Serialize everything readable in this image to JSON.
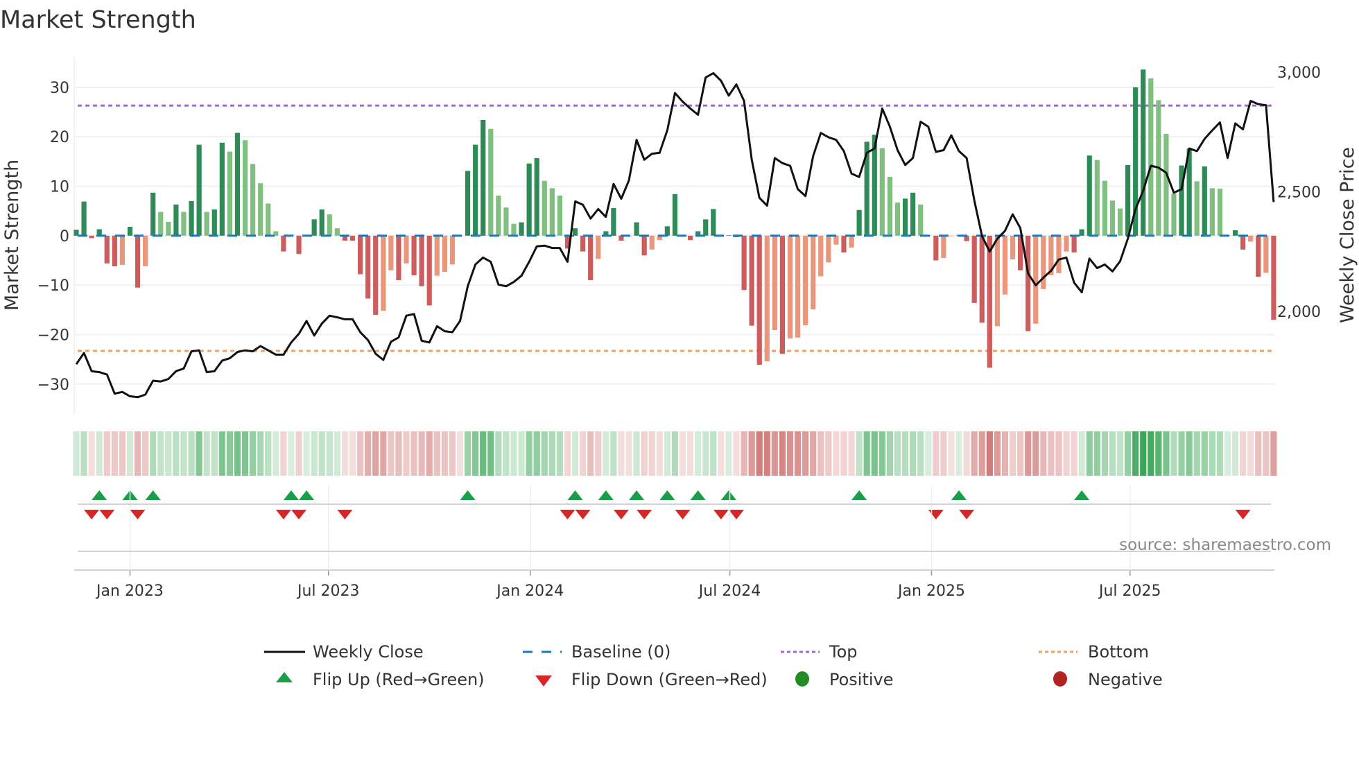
{
  "chart_data": {
    "type": "bar",
    "title": "Market Strength",
    "ylabel": "Market Strength",
    "y2label": "Weekly Close Price",
    "ylim": [
      -36.2,
      36.3
    ],
    "y2lim": [
      1568,
      3067
    ],
    "yticks": [
      30,
      20,
      10,
      0,
      -10,
      -20,
      -30
    ],
    "yticklabels": [
      "30",
      "20",
      "10",
      "0",
      "−10",
      "−20",
      "−30"
    ],
    "y2ticks": [
      3000,
      2500,
      2000
    ],
    "y2ticklabels": [
      "3,000",
      "2,500",
      "2,000"
    ],
    "x": {
      "start": "2022-11-13",
      "freq": "weekly"
    },
    "xticks": [
      {
        "date": "2023-01-01",
        "label": "Jan 2023"
      },
      {
        "date": "2023-07-01",
        "label": "Jul 2023"
      },
      {
        "date": "2024-01-01",
        "label": "Jan 2024"
      },
      {
        "date": "2024-07-01",
        "label": "Jul 2024"
      },
      {
        "date": "2025-01-01",
        "label": "Jan 2025"
      },
      {
        "date": "2025-07-01",
        "label": "Jul 2025"
      }
    ],
    "top_level": 26.3,
    "bottom_level": -23.3,
    "baseline": 0,
    "grid": true,
    "legend_position": "bottom",
    "strength": [
      1.2,
      6.9,
      -0.5,
      1.3,
      -5.6,
      -6.2,
      -5.9,
      1.8,
      -10.5,
      -6.2,
      8.7,
      4.8,
      2.8,
      6.3,
      4.8,
      7.0,
      18.4,
      4.8,
      5.3,
      18.8,
      17.0,
      20.8,
      19.3,
      14.5,
      10.6,
      6.5,
      0.9,
      -3.2,
      0.2,
      -3.7,
      0.2,
      3.3,
      5.3,
      4.3,
      1.5,
      -1.0,
      -1.0,
      -7.8,
      -12.7,
      -16.0,
      -15.2,
      -7.0,
      -9.0,
      -5.6,
      -8.0,
      -10.2,
      -14.1,
      -8.1,
      -7.3,
      -5.8,
      -0.1,
      13.1,
      18.4,
      23.4,
      21.6,
      8.1,
      5.7,
      2.4,
      2.7,
      14.6,
      15.7,
      11.1,
      9.6,
      8.1,
      -2.6,
      1.5,
      -3.2,
      -9.0,
      -4.7,
      0.9,
      5.6,
      -1.0,
      -0.1,
      2.7,
      -4.0,
      -2.8,
      -0.9,
      1.9,
      8.4,
      -0.2,
      -0.9,
      0.9,
      3.3,
      5.4,
      -0.1,
      0.1,
      -0.3,
      -11.0,
      -18.2,
      -26.1,
      -25.4,
      -19.1,
      -23.9,
      -20.8,
      -20.6,
      -18.1,
      -14.9,
      -8.2,
      -5.4,
      -1.8,
      -3.4,
      -2.4,
      5.2,
      19.0,
      20.4,
      17.7,
      11.9,
      6.7,
      7.5,
      8.7,
      6.3,
      0.1,
      -5.0,
      -4.5,
      -0.1,
      0.1,
      -1.1,
      -13.6,
      -17.6,
      -26.7,
      -18.3,
      -11.9,
      -4.8,
      -7.0,
      -19.3,
      -17.8,
      -10.8,
      -8.0,
      -7.6,
      -3.2,
      -3.4,
      1.3,
      16.2,
      15.3,
      11.1,
      7.1,
      5.5,
      14.3,
      30.0,
      33.6,
      31.8,
      27.4,
      20.6,
      8.5,
      14.2,
      17.6,
      11.0,
      14.0,
      9.6,
      9.5,
      0.1,
      1.1,
      -2.8,
      -1.2,
      -8.3,
      -7.5,
      -17.0
    ],
    "weekly_close": [
      1779,
      1826,
      1750,
      1746,
      1736,
      1656,
      1663,
      1645,
      1641,
      1652,
      1710,
      1707,
      1717,
      1750,
      1761,
      1833,
      1837,
      1746,
      1750,
      1794,
      1804,
      1830,
      1837,
      1833,
      1855,
      1837,
      1819,
      1819,
      1870,
      1906,
      1960,
      1899,
      1949,
      1982,
      1975,
      1967,
      1967,
      1913,
      1880,
      1823,
      1797,
      1873,
      1891,
      1982,
      1989,
      1877,
      1870,
      1938,
      1917,
      1913,
      1960,
      2105,
      2196,
      2225,
      2207,
      2112,
      2105,
      2123,
      2149,
      2207,
      2272,
      2275,
      2265,
      2265,
      2207,
      2460,
      2446,
      2388,
      2428,
      2395,
      2533,
      2471,
      2547,
      2717,
      2634,
      2659,
      2663,
      2757,
      2913,
      2877,
      2848,
      2822,
      2978,
      2996,
      2964,
      2902,
      2949,
      2880,
      2634,
      2475,
      2442,
      2641,
      2620,
      2609,
      2511,
      2482,
      2649,
      2746,
      2728,
      2717,
      2670,
      2576,
      2562,
      2663,
      2681,
      2848,
      2772,
      2674,
      2612,
      2641,
      2793,
      2772,
      2667,
      2674,
      2736,
      2670,
      2641,
      2464,
      2315,
      2250,
      2304,
      2337,
      2406,
      2348,
      2159,
      2109,
      2141,
      2170,
      2217,
      2225,
      2120,
      2080,
      2221,
      2181,
      2196,
      2167,
      2210,
      2304,
      2428,
      2504,
      2609,
      2601,
      2580,
      2496,
      2511,
      2681,
      2670,
      2721,
      2757,
      2790,
      2641,
      2786,
      2761,
      2880,
      2866,
      2862,
      2457
    ],
    "legend": [
      {
        "key": "close",
        "label": "Weekly Close"
      },
      {
        "key": "baseline",
        "label": "Baseline (0)"
      },
      {
        "key": "top",
        "label": "Top"
      },
      {
        "key": "bottom",
        "label": "Bottom"
      },
      {
        "key": "flip_up",
        "label": "Flip Up (Red→Green)"
      },
      {
        "key": "flip_down",
        "label": "Flip Down (Green→Red)"
      },
      {
        "key": "positive",
        "label": "Positive"
      },
      {
        "key": "negative",
        "label": "Negative"
      }
    ],
    "source": "source: sharemaestro.com"
  },
  "colors": {
    "pos_rising": "#2e8b57",
    "pos_falling": "#7fbf7f",
    "neg_falling": "#cd5c5c",
    "neg_rising": "#e9967a",
    "baseline": "#1f77b4",
    "top": "#a066e0",
    "bottom": "#f0a060",
    "close": "#111111",
    "flip_up": "#1a9e4a",
    "flip_down": "#d62728",
    "positive": "#228b22",
    "negative": "#b22222",
    "strip_pos": "#3aa655",
    "strip_neg": "#c8605e"
  }
}
